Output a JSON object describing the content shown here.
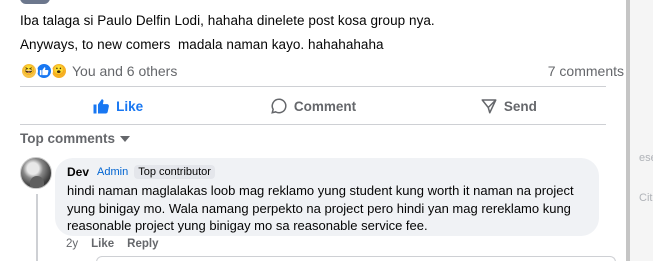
{
  "post": {
    "line1": "Iba talaga si Paulo Delfin Lodi, hahaha dinelete post kosa group nya.",
    "line2": "Anyways, to new comers  madala naman kayo. hahahahaha",
    "reactions_text": "You and 6 others",
    "comments_count_text": "7 comments",
    "reaction_icons": [
      "haha-icon",
      "like-icon",
      "wow-icon"
    ]
  },
  "actions": {
    "like_label": "Like",
    "comment_label": "Comment",
    "send_label": "Send"
  },
  "sort": {
    "label": "Top comments"
  },
  "comment": {
    "author": "Dev",
    "badge_admin": "Admin",
    "badge_top": "Top contributor",
    "text_line1": "hindi naman maglalakas loob mag reklamo yung student kung worth it naman na project",
    "text_line2": "yung binigay mo. Wala namang perpekto na project pero hindi yan mag rereklamo kung",
    "text_line3": "reasonable project yung binigay mo sa reasonable service fee.",
    "age": "2y",
    "like_label": "Like",
    "reply_label": "Reply"
  },
  "side": {
    "label1": "ese",
    "label2": "Cit"
  },
  "colors": {
    "accent": "#1877f2",
    "muted": "#65676b",
    "bubble": "#f0f2f5",
    "admin_badge": "#0064d1"
  }
}
